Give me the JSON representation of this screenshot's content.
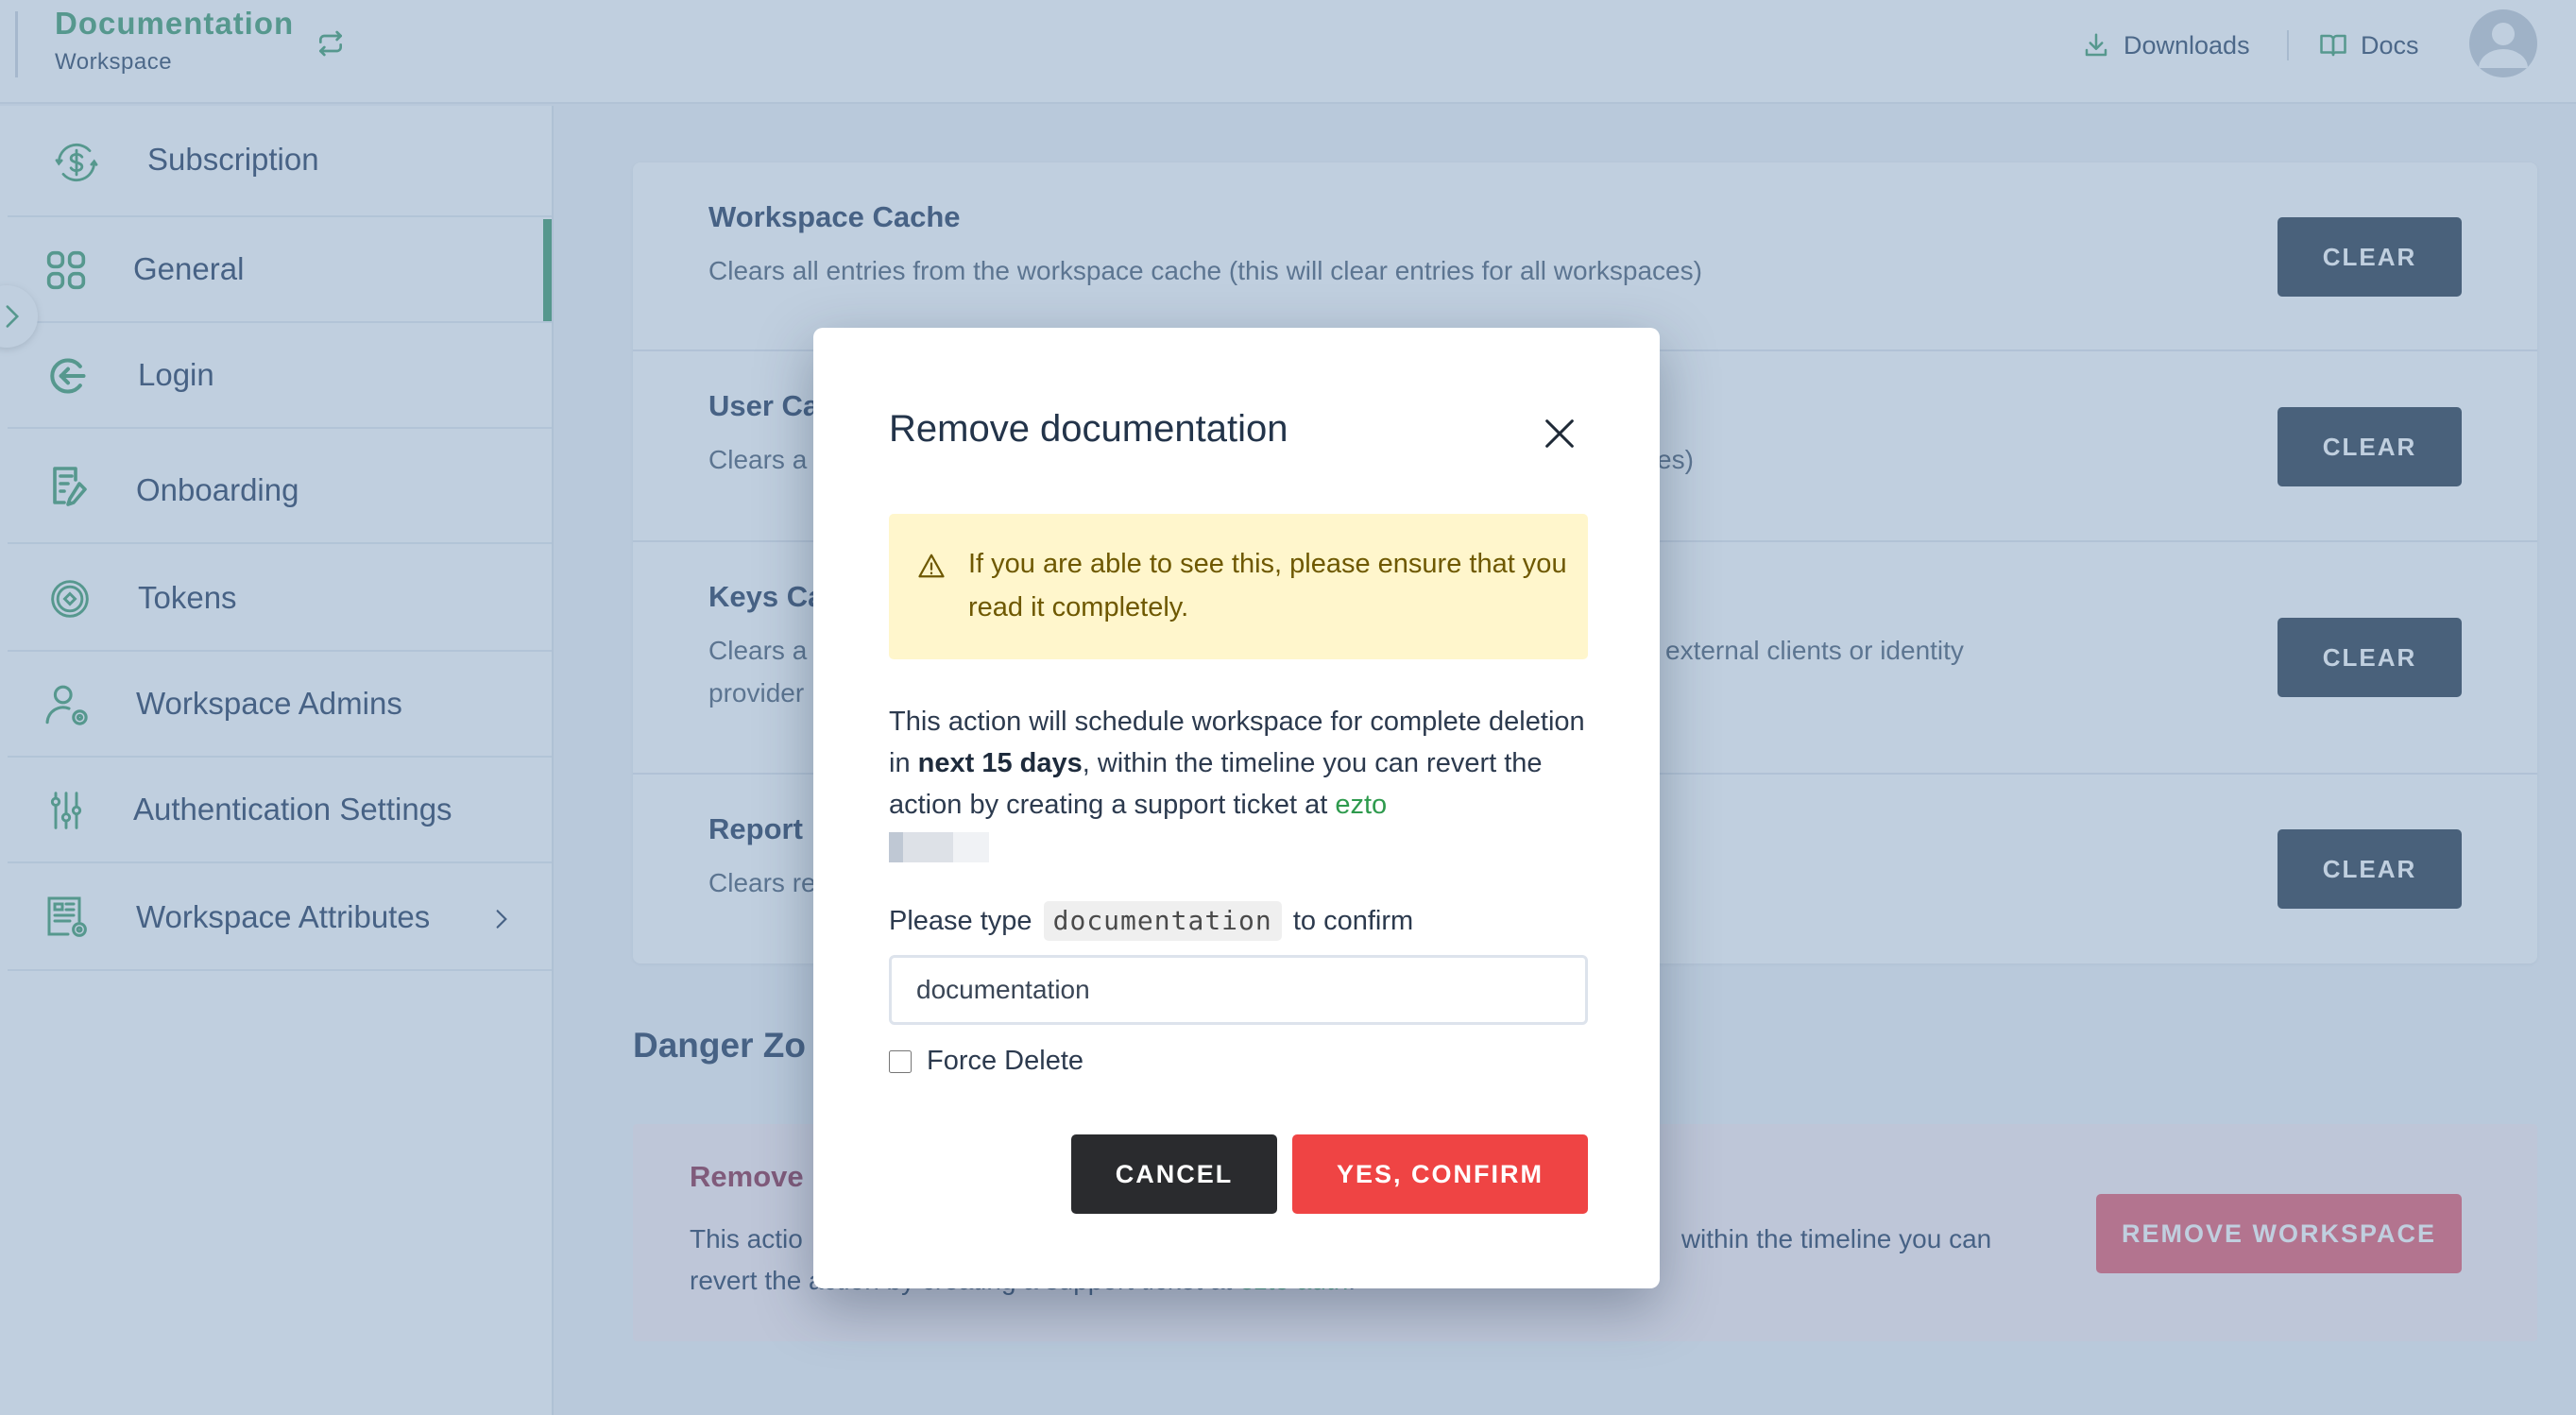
{
  "header": {
    "workspace_name": "Documentation",
    "workspace_label": "Workspace",
    "links": [
      {
        "label": "Downloads",
        "icon": "download-icon"
      },
      {
        "label": "Docs",
        "icon": "book-icon"
      }
    ],
    "avatar_icon": "user-avatar-icon"
  },
  "sidebar": {
    "items": [
      {
        "label": "Subscription",
        "icon": "dollar-cycle-icon",
        "active": false
      },
      {
        "label": "General",
        "icon": "grid-icon",
        "active": true
      },
      {
        "label": "Login",
        "icon": "login-arrow-icon",
        "active": false
      },
      {
        "label": "Onboarding",
        "icon": "document-edit-icon",
        "active": false
      },
      {
        "label": "Tokens",
        "icon": "token-icon",
        "active": false
      },
      {
        "label": "Workspace Admins",
        "icon": "user-gear-icon",
        "active": false
      },
      {
        "label": "Authentication Settings",
        "icon": "sliders-icon",
        "active": false
      },
      {
        "label": "Workspace Attributes",
        "icon": "form-gear-icon",
        "active": false,
        "has_submenu": true
      }
    ]
  },
  "main": {
    "cache_rows": [
      {
        "title": "Workspace Cache",
        "description": "Clears all entries from the workspace cache (this will clear entries for all workspaces)",
        "button": "CLEAR"
      },
      {
        "title": "User Ca",
        "description_left": "Clears a",
        "description_right": "ces)",
        "button": "CLEAR"
      },
      {
        "title": "Keys Ca",
        "description_left": "Clears a",
        "description_right": "external clients or identity",
        "description_line2": "provider",
        "button": "CLEAR"
      },
      {
        "title": "Report",
        "description_left": "Clears re",
        "button": "CLEAR"
      }
    ],
    "danger_zone": {
      "title": "Danger Zo",
      "row_title": "Remove",
      "desc_line1_left": "This actio",
      "desc_line1_right": "within the timeline you can",
      "desc_line2_left": "revert the",
      "desc_line2_mid": " action by creating a support ticket at ",
      "desc_link": "ezto auth",
      "desc_end": ".",
      "button": "REMOVE WORKSPACE"
    }
  },
  "modal": {
    "title": "Remove documentation",
    "alert": "If you are able to see this, please ensure that you read it completely.",
    "body_pre": "This action will schedule workspace for complete deletion in ",
    "body_bold": "next 15 days",
    "body_post": ", within the timeline you can revert the action by creating a support ticket at ",
    "body_link": "ezto",
    "confirm_pre": "Please type",
    "confirm_code": "documentation",
    "confirm_post": "to confirm",
    "input_value": "documentation",
    "force_delete_label": "Force Delete",
    "force_delete_checked": false,
    "cancel_label": "CANCEL",
    "confirm_label": "YES, CONFIRM"
  },
  "colors": {
    "brand_green": "#3e9b6c",
    "dark_button": "#273849",
    "danger_red": "#ef4444",
    "alert_bg": "#fff6cc"
  }
}
